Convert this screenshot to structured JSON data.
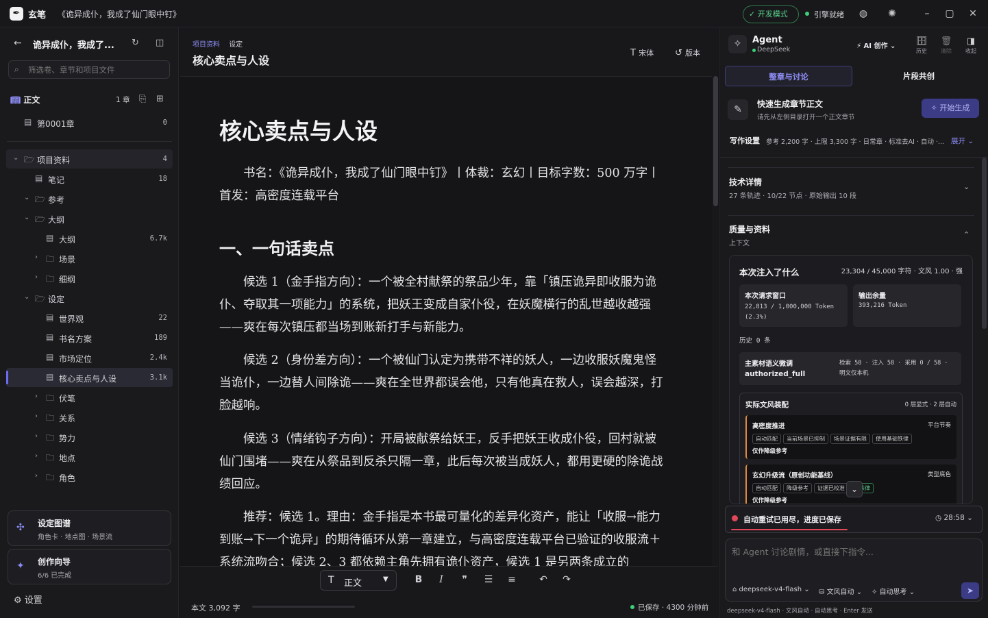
{
  "titlebar": {
    "app_name": "玄笔",
    "doc_title": "《诡异成仆，我成了仙门眼中钉》",
    "devmode": "开发模式",
    "engine_status": "引擎就绪"
  },
  "sidebar": {
    "project_name": "诡异成仆，我成了...",
    "search_placeholder": "筛选卷、章节和项目文件",
    "main_section": {
      "label": "正文",
      "count": "1 章"
    },
    "chapter": {
      "label": "第0001章",
      "count": "0"
    },
    "items": [
      {
        "label": "项目资料",
        "count": "4",
        "level": 0,
        "type": "folder",
        "expanded": true
      },
      {
        "label": "笔记",
        "count": "18",
        "level": 1,
        "type": "file"
      },
      {
        "label": "参考",
        "count": "",
        "level": 1,
        "type": "folder",
        "expanded": true
      },
      {
        "label": "大纲",
        "count": "",
        "level": 1,
        "type": "folder",
        "expanded": true
      },
      {
        "label": "大纲",
        "count": "6.7k",
        "level": 2,
        "type": "file"
      },
      {
        "label": "场景",
        "count": "",
        "level": 2,
        "type": "folder",
        "expanded": false
      },
      {
        "label": "细纲",
        "count": "",
        "level": 2,
        "type": "folder",
        "expanded": false
      },
      {
        "label": "设定",
        "count": "",
        "level": 1,
        "type": "folder",
        "expanded": true
      },
      {
        "label": "世界观",
        "count": "22",
        "level": 2,
        "type": "file"
      },
      {
        "label": "书名方案",
        "count": "189",
        "level": 2,
        "type": "file"
      },
      {
        "label": "市场定位",
        "count": "2.4k",
        "level": 2,
        "type": "file"
      },
      {
        "label": "核心卖点与人设",
        "count": "3.1k",
        "level": 2,
        "type": "file",
        "active": true
      },
      {
        "label": "伏笔",
        "count": "",
        "level": 2,
        "type": "folder",
        "expanded": false
      },
      {
        "label": "关系",
        "count": "",
        "level": 2,
        "type": "folder",
        "expanded": false
      },
      {
        "label": "势力",
        "count": "",
        "level": 2,
        "type": "folder",
        "expanded": false
      },
      {
        "label": "地点",
        "count": "",
        "level": 2,
        "type": "folder",
        "expanded": false
      },
      {
        "label": "角色",
        "count": "",
        "level": 2,
        "type": "folder",
        "expanded": false
      }
    ],
    "cards": [
      {
        "title": "设定图谱",
        "sub": "角色卡 · 地点图 · 场景流"
      },
      {
        "title": "创作向导",
        "sub": "6/6 已完成"
      }
    ],
    "settings_label": "设置"
  },
  "editor": {
    "breadcrumb": [
      "项目资料",
      "设定"
    ],
    "title": "核心卖点与人设",
    "font_btn": "宋体",
    "version_btn": "版本",
    "doc": {
      "h1": "核心卖点与人设",
      "intro": "书名：《诡异成仆，我成了仙门眼中钉》丨体裁：玄幻丨目标字数：500 万字丨首发：高密度连载平台",
      "h2": "一、一句话卖点",
      "p1": "候选 1（金手指方向）：一个被全村献祭的祭品少年，靠「镇压诡异即收服为诡仆、夺取其一项能力」的系统，把妖王变成自家仆役，在妖魔横行的乱世越收越强——爽在每次镇压都当场到账新打手与新能力。",
      "p2": "候选 2（身份差方向）：一个被仙门认定为携带不祥的妖人，一边收服妖魔鬼怪当诡仆，一边替人间除诡——爽在全世界都误会他，只有他真在救人，误会越深，打脸越响。",
      "p3": "候选 3（情绪钩子方向）：开局被献祭给妖王，反手把妖王收成仆役，回村就被仙门围堵——爽在从祭品到反杀只隔一章，此后每次被当成妖人，都用更硬的除诡战绩回应。",
      "p4": "推荐：候选 1。理由：金手指是本书最可量化的差异化资产，能让「收服→能力到账→下一个诡异」的期待循环从第一章建立，与高密度连载平台已验证的收服流＋系统流吻合；候选 2、3 都依赖主角先拥有诡仆资产，候选 1 是另两条成立的"
    },
    "format_select": "正文",
    "word_count": "本文 3,092 字",
    "saved": "已保存 · 4300 分钟前"
  },
  "agent": {
    "name": "Agent",
    "model": "DeepSeek",
    "mode": "AI 创作",
    "icons": [
      {
        "label": "历史"
      },
      {
        "label": "清除"
      },
      {
        "label": "收起"
      }
    ],
    "tabs": [
      "整章与讨论",
      "片段共创"
    ],
    "quick": {
      "title": "快速生成章节正文",
      "sub": "请先从左侧目录打开一个正文章节",
      "btn": "开始生成"
    },
    "writing": {
      "label": "写作设置",
      "value": "参考 2,200 字 · 上限 3,300 字 · 日常章 · 标准去AI · 自动 ·...",
      "more": "展开"
    },
    "tech": {
      "title": "技术详情",
      "sub": "27 条轨迹 · 10/22 节点 · 原始输出 10 段"
    },
    "quality": {
      "title": "质量与资料",
      "sub": "上下文"
    },
    "context": {
      "title": "本次注入了什么",
      "stats": "23,304 / 45,000 字符 · 文风 1.00 · 强",
      "window_label": "本次请求窗口",
      "window_value": "22,813 / 1,000,000 Token (2.3%)",
      "output_label": "输出余量",
      "output_value": "393,216 Token",
      "history": "历史 0 条",
      "material_label": "主素材语义微调",
      "material_value": "authorized_full",
      "material_stats": "检索 58 · 注入 58 · 采用 0 / 58 · 明文仅本机",
      "style_title": "实际文风装配",
      "style_meta": "0 层显式 · 2 层自动",
      "layer1": {
        "title": "高密度推进",
        "tag": "平台节奏",
        "chips": [
          "自动匹配",
          "当前场景已抑制",
          "场景证据有限",
          "使用基础铁律"
        ],
        "note": "仅作降级参考"
      },
      "layer2": {
        "title": "玄幻升级流（原创功能基线）",
        "tag": "类型底色",
        "chips": [
          "自动匹配",
          "降级参考",
          "证据已校准",
          "础铁律"
        ],
        "note": "仅作降级参考"
      }
    },
    "running": {
      "text": "自动重试已用尽，进度已保存",
      "time": "28:58"
    },
    "chat_placeholder": "和 Agent 讨论剧情，或直接下指令...",
    "chat_opts": [
      "deepseek-v4-flash",
      "文风自动",
      "自动思考"
    ],
    "footer": "deepseek-v4-flash · 文风自动 · 自动思考 · Enter 发送"
  },
  "colors": {
    "accent": "#8f8ff8",
    "ok": "#3ecf7a",
    "error": "#e04858"
  }
}
